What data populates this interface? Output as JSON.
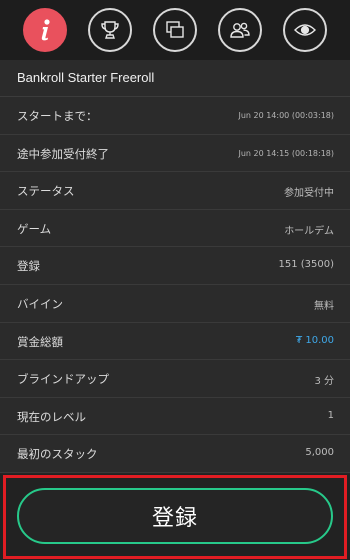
{
  "colors": {
    "accent_red": "#e9515d",
    "accent_green": "#27c98a",
    "accent_blue": "#3fa8e8",
    "highlight_frame": "#e21d23"
  },
  "tabs": [
    {
      "icon": "info-icon",
      "active": true
    },
    {
      "icon": "trophy-icon",
      "active": false
    },
    {
      "icon": "tables-icon",
      "active": false
    },
    {
      "icon": "players-icon",
      "active": false
    },
    {
      "icon": "eye-icon",
      "active": false
    }
  ],
  "tournament": {
    "title": "Bankroll Starter Freeroll"
  },
  "details": [
    {
      "label": "スタートまで：",
      "value": "Jun 20 14:00 (00:03:18)"
    },
    {
      "label": "途中参加受付終了",
      "value": "Jun 20 14:15 (00:18:18)"
    },
    {
      "label": "ステータス",
      "value": "参加受付中"
    },
    {
      "label": "ゲーム",
      "value": "ホールデム"
    },
    {
      "label": "登録",
      "value": "151 (3500)"
    },
    {
      "label": "バイイン",
      "value": "無料"
    },
    {
      "label": "賞金総額",
      "value": "₮ 10.00"
    },
    {
      "label": "ブラインドアップ",
      "value": "3 分"
    },
    {
      "label": "現在のレベル",
      "value": "1"
    },
    {
      "label": "最初のスタック",
      "value": "5,000"
    }
  ],
  "register_button": {
    "label": "登録"
  }
}
